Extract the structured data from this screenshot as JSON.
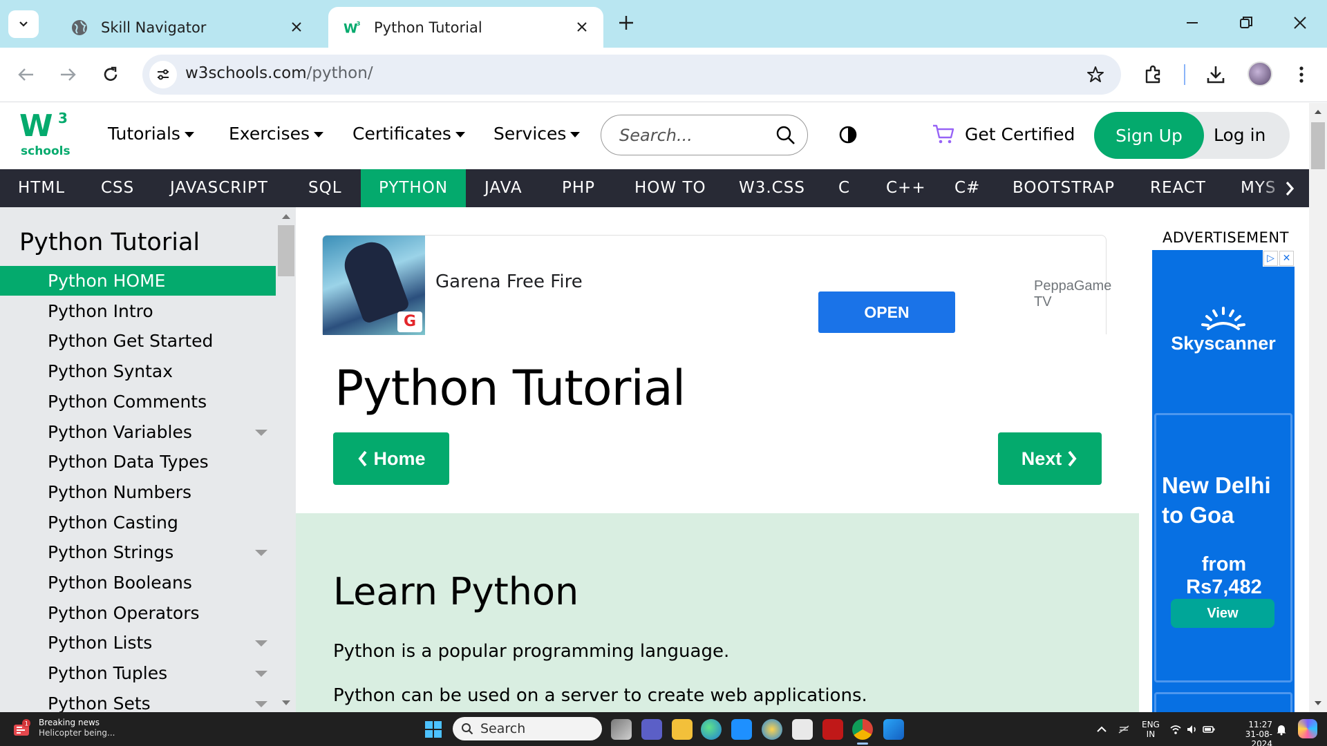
{
  "browser": {
    "tabs": [
      {
        "title": "Skill Navigator",
        "active": false,
        "icon": "globe-icon"
      },
      {
        "title": "Python Tutorial",
        "active": true,
        "icon": "w3schools-favicon"
      }
    ],
    "url_host": "w3schools.com",
    "url_path": "/python/"
  },
  "header": {
    "logo_sup": "3",
    "logo_text": "schools",
    "menus": [
      "Tutorials",
      "Exercises",
      "Certificates",
      "Services"
    ],
    "search_placeholder": "Search...",
    "get_certified": "Get Certified",
    "sign_up": "Sign Up",
    "log_in": "Log in"
  },
  "topnav": {
    "items": [
      "HTML",
      "CSS",
      "JAVASCRIPT",
      "SQL",
      "PYTHON",
      "JAVA",
      "PHP",
      "HOW TO",
      "W3.CSS",
      "C",
      "C++",
      "C#",
      "BOOTSTRAP",
      "REACT",
      "MYS"
    ],
    "active": "PYTHON"
  },
  "sidebar": {
    "title": "Python Tutorial",
    "items": [
      {
        "label": "Python HOME",
        "active": true,
        "expandable": false
      },
      {
        "label": "Python Intro",
        "active": false,
        "expandable": false
      },
      {
        "label": "Python Get Started",
        "active": false,
        "expandable": false
      },
      {
        "label": "Python Syntax",
        "active": false,
        "expandable": false
      },
      {
        "label": "Python Comments",
        "active": false,
        "expandable": false
      },
      {
        "label": "Python Variables",
        "active": false,
        "expandable": true
      },
      {
        "label": "Python Data Types",
        "active": false,
        "expandable": false
      },
      {
        "label": "Python Numbers",
        "active": false,
        "expandable": false
      },
      {
        "label": "Python Casting",
        "active": false,
        "expandable": false
      },
      {
        "label": "Python Strings",
        "active": false,
        "expandable": true
      },
      {
        "label": "Python Booleans",
        "active": false,
        "expandable": false
      },
      {
        "label": "Python Operators",
        "active": false,
        "expandable": false
      },
      {
        "label": "Python Lists",
        "active": false,
        "expandable": true
      },
      {
        "label": "Python Tuples",
        "active": false,
        "expandable": true
      },
      {
        "label": "Python Sets",
        "active": false,
        "expandable": true
      }
    ]
  },
  "ad_top": {
    "app_name": "Garena Free Fire",
    "button": "OPEN",
    "advertiser": "PeppaGame TV"
  },
  "main": {
    "title": "Python Tutorial",
    "home_button": "Home",
    "next_button": "Next",
    "learn_heading": "Learn Python",
    "paragraphs": [
      "Python is a popular programming language.",
      "Python can be used on a server to create web applications."
    ]
  },
  "ad_right": {
    "label": "ADVERTISEMENT",
    "brand": "Skyscanner",
    "destination_line1": "New Delhi",
    "destination_line2": "to Goa",
    "price": "from Rs7,482",
    "button": "View"
  },
  "taskbar": {
    "news_title": "Breaking news",
    "news_sub": "Helicopter being...",
    "news_badge": "1",
    "search": "Search",
    "lang1": "ENG",
    "lang2": "IN",
    "time": "11:27",
    "date": "31-08-2024"
  },
  "colors": {
    "w3_green": "#04aa6d",
    "topnav_dark": "#282a35",
    "sidebar_bg": "#e7e9eb",
    "learn_bg": "#d9eee1",
    "skyscanner_blue": "#0770e3",
    "chrome_tabstrip": "#b9e6f1"
  }
}
